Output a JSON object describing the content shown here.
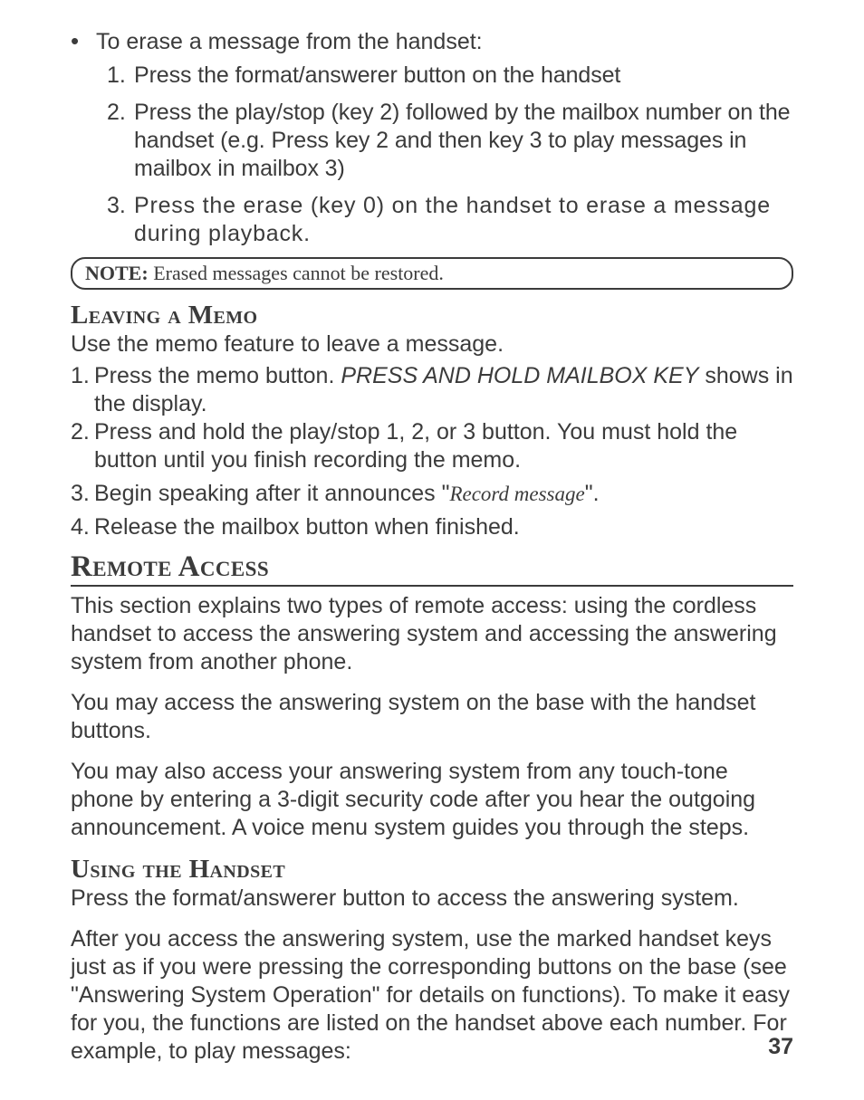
{
  "erase_section": {
    "bullet": "To erase a message from the handset:",
    "items": [
      {
        "n": "1.",
        "text": "Press the format/answerer button on the handset"
      },
      {
        "n": "2.",
        "text": "Press the play/stop (key 2) followed by the mailbox number on the handset (e.g. Press key 2 and then key 3 to play messages in mailbox in mailbox 3)"
      },
      {
        "n": "3.",
        "text": "Press the erase (key 0) on the handset to erase a message during playback."
      }
    ]
  },
  "note": {
    "label": "NOTE:",
    "text": " Erased messages cannot be restored."
  },
  "leaving_memo": {
    "heading": "Leaving a Memo",
    "intro": "Use the memo feature to leave a message.",
    "items": [
      {
        "n": "1.",
        "pre": "Press the memo button. ",
        "ital": "PRESS AND HOLD MAILBOX KEY",
        "post": " shows in the display."
      },
      {
        "n": "2.",
        "pre": "Press and hold the play/stop 1, 2, or 3 button. You must hold the button until you finish recording the memo.",
        "ital": "",
        "post": ""
      },
      {
        "n": "3.",
        "pre": "Begin speaking after it announces \"",
        "ital": "Record message",
        "post": "\"."
      },
      {
        "n": "4.",
        "pre": "Release the mailbox button when finished.",
        "ital": "",
        "post": ""
      }
    ]
  },
  "remote_access": {
    "heading": "Remote Access",
    "p1": "This section explains two types of remote access: using the cordless handset to access the answering system and accessing the answering system from another phone.",
    "p2": "You may access the answering system on the base with the handset buttons.",
    "p3": "You may also access your answering system from any touch-tone phone by entering a 3-digit security code after you hear the outgoing announcement. A voice menu system guides you through the steps."
  },
  "using_handset": {
    "heading": "Using the Handset",
    "p1": "Press the format/answerer button to access the answering system.",
    "p2": "After you access the answering system, use the marked handset keys just as if you were pressing the corresponding buttons on the base (see \"Answering System Operation\" for details on functions). To make it easy for you, the functions are listed on the handset above each number. For example, to play messages:"
  },
  "page_number": "37"
}
